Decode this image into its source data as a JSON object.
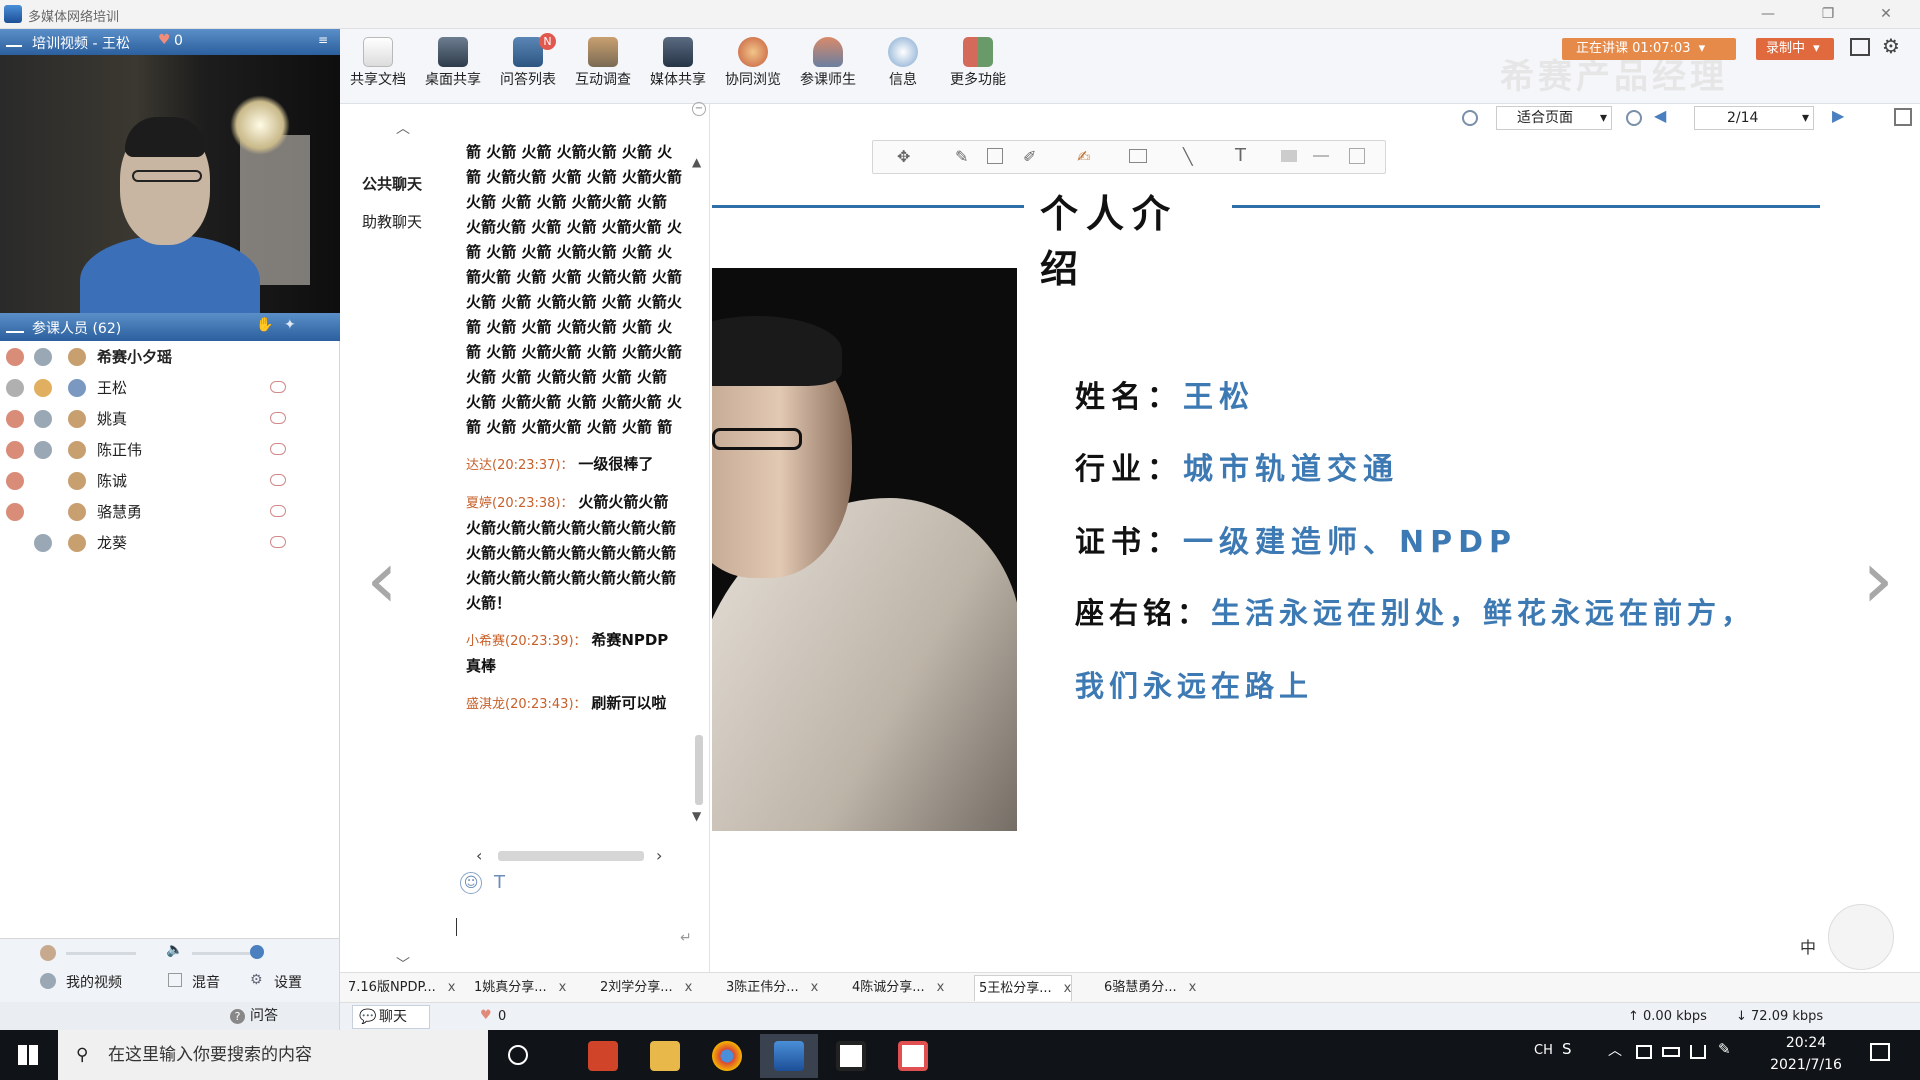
{
  "window": {
    "title": "多媒体网络培训",
    "minimize": "—",
    "restore": "❐",
    "close": "✕"
  },
  "left": {
    "video_header": "培训视频 - 王松",
    "video_likes": "0",
    "participants_header": "参课人员 (62)",
    "participants": [
      {
        "name": "希赛小夕瑶",
        "bold": true
      },
      {
        "name": "王松",
        "bold": false
      },
      {
        "name": "姚真",
        "bold": false
      },
      {
        "name": "陈正伟",
        "bold": false
      },
      {
        "name": "陈诚",
        "bold": false
      },
      {
        "name": "骆慧勇",
        "bold": false
      },
      {
        "name": "龙葵",
        "bold": false
      }
    ],
    "my_video": "我的视频",
    "mix": "混音",
    "settings": "设置",
    "qa_tab": "问答",
    "chat_tab": "聊天",
    "likes": "0"
  },
  "toolbar": {
    "items": [
      {
        "label": "共享文档",
        "icon": "document-icon"
      },
      {
        "label": "桌面共享",
        "icon": "desktop-share-icon"
      },
      {
        "label": "问答列表",
        "icon": "qa-list-icon",
        "badge": "N"
      },
      {
        "label": "互动调查",
        "icon": "survey-icon"
      },
      {
        "label": "媒体共享",
        "icon": "media-share-icon"
      },
      {
        "label": "协同浏览",
        "icon": "browser-icon"
      },
      {
        "label": "参课师生",
        "icon": "people-icon"
      },
      {
        "label": "信息",
        "icon": "info-icon"
      },
      {
        "label": "更多功能",
        "icon": "more-icon"
      }
    ],
    "lecture_status": "正在讲课 01:07:03",
    "record": "录制中",
    "watermark": "希赛产品经理"
  },
  "chat": {
    "tabs": [
      "公共聊天",
      "助教聊天"
    ],
    "flood_text": "箭 火箭 火箭 火箭火箭 火箭 火箭 火箭火箭 火箭 火箭 火箭火箭 火箭 火箭 火箭 火箭火箭 火箭 火箭火箭 火箭 火箭 火箭火箭 火箭 火箭 火箭 火箭火箭 火箭 火箭火箭 火箭 火箭 火箭火箭 火箭 火箭 火箭 火箭火箭 火箭 火箭火箭 火箭 火箭 火箭火箭 火箭 火箭 火箭 火箭火箭 火箭 火箭火箭 火箭 火箭 火箭火箭 火箭 火箭 火箭 火箭火箭 火箭 火箭火箭 火箭 火箭 火箭火箭 火箭 火箭 箭",
    "messages": [
      {
        "sender": "达达(20:23:37)：",
        "text": "一级很棒了"
      },
      {
        "sender": "夏婷(20:23:38)：",
        "text": "火箭火箭火箭火箭火箭火箭火箭火箭火箭火箭火箭火箭火箭火箭火箭火箭火箭火箭火箭火箭火箭火箭火箭火箭火箭！"
      },
      {
        "sender": "小希赛(20:23:39)：",
        "text": "希赛NPDP真棒"
      },
      {
        "sender": "盛淇龙(20:23:43)：",
        "text": "刷新可以啦"
      }
    ],
    "input_value": ""
  },
  "slide": {
    "fit_mode": "适合页面",
    "page": "2/14",
    "title": "个人介绍",
    "rows": [
      {
        "label": "姓名：",
        "value": "王松"
      },
      {
        "label": "行业：",
        "value": "城市轨道交通"
      },
      {
        "label": "证书：",
        "value": "一级建造师、NPDP"
      },
      {
        "label": "座右铭：",
        "value": "生活永远在别处，鲜花永远在前方，"
      }
    ],
    "motto_line2": "我们永远在路上",
    "prev": "‹",
    "next": "›"
  },
  "doc_tabs": [
    {
      "label": "7.16版NPDP..."
    },
    {
      "label": "1姚真分享..."
    },
    {
      "label": "2刘学分享..."
    },
    {
      "label": "3陈正伟分..."
    },
    {
      "label": "4陈诚分享..."
    },
    {
      "label": "5王松分享...",
      "active": true
    },
    {
      "label": "6骆慧勇分..."
    }
  ],
  "status": {
    "upload": "↑ 0.00 kbps",
    "download": "↓ 72.09 kbps"
  },
  "taskbar": {
    "search_placeholder": "在这里输入你要搜索的内容",
    "lang": "CH",
    "ime": "中",
    "time": "20:24",
    "date": "2021/7/16"
  },
  "colors": {
    "accent_blue": "#3d79b3",
    "header_blue": "#2b5f9e",
    "status_orange": "#e68a4a"
  }
}
